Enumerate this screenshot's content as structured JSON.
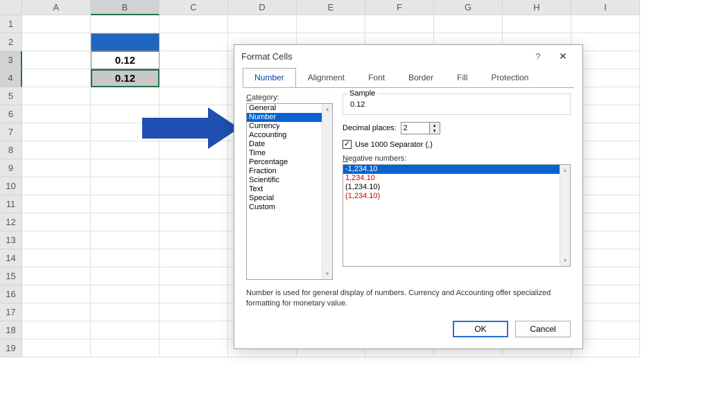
{
  "columns": [
    "A",
    "B",
    "C",
    "D",
    "E",
    "F",
    "G",
    "H",
    "I"
  ],
  "rows": [
    "1",
    "2",
    "3",
    "4",
    "5",
    "6",
    "7",
    "8",
    "9",
    "10",
    "11",
    "12",
    "13",
    "14",
    "15",
    "16",
    "17",
    "18",
    "19"
  ],
  "cells": {
    "b3": "0.12",
    "b4": "0.12"
  },
  "dialog": {
    "title": "Format Cells",
    "help": "?",
    "close": "✕",
    "tabs": [
      "Number",
      "Alignment",
      "Font",
      "Border",
      "Fill",
      "Protection"
    ],
    "category_label": "Category:",
    "categories": [
      "General",
      "Number",
      "Currency",
      "Accounting",
      "Date",
      "Time",
      "Percentage",
      "Fraction",
      "Scientific",
      "Text",
      "Special",
      "Custom"
    ],
    "sample_label": "Sample",
    "sample_value": "0.12",
    "decimal_label": "Decimal places:",
    "decimal_value": "2",
    "separator_label": "Use 1000 Separator (,)",
    "negative_label": "Negative numbers:",
    "negatives": [
      "-1,234.10",
      "1,234.10",
      "(1,234.10)",
      "(1,234.10)"
    ],
    "description": "Number is used for general display of numbers.  Currency and Accounting offer specialized formatting for monetary value.",
    "ok": "OK",
    "cancel": "Cancel"
  }
}
